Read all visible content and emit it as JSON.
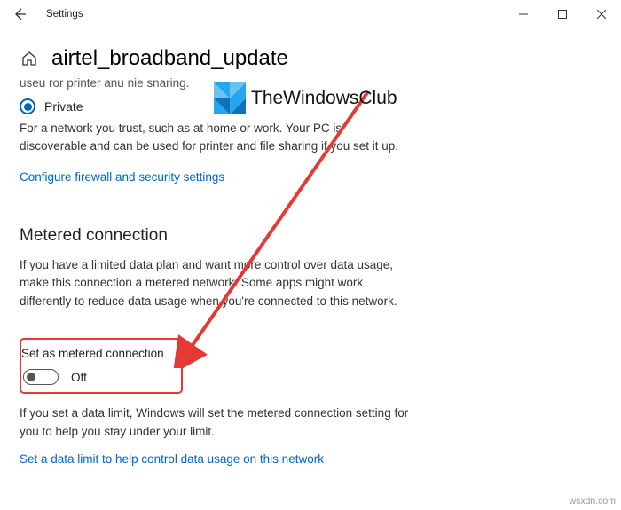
{
  "window": {
    "title": "Settings"
  },
  "page": {
    "network_name": "airtel_broadband_update"
  },
  "truncated_line": "useu ror printer anu nie snaring.",
  "private": {
    "label": "Private",
    "desc": "For a network you trust, such as at home or work. Your PC is discoverable and can be used for printer and file sharing if you set it up."
  },
  "firewall_link": "Configure firewall and security settings",
  "metered": {
    "heading": "Metered connection",
    "desc": "If you have a limited data plan and want more control over data usage, make this connection a metered network. Some apps might work differently to reduce data usage when you're connected to this network.",
    "toggle_label": "Set as metered connection",
    "toggle_state": "Off",
    "under_desc": "If you set a data limit, Windows will set the metered connection setting for you to help you stay under your limit.",
    "limit_link": "Set a data limit to help control data usage on this network"
  },
  "overlay": {
    "brand": "TheWindowsClub"
  },
  "watermark": "wsxdn.com"
}
